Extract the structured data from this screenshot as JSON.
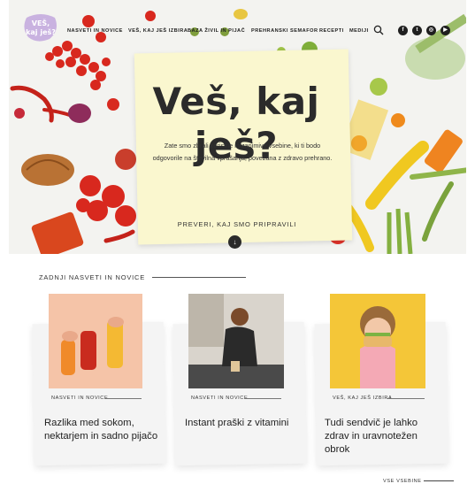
{
  "brand": {
    "logo_text": "VEŠ, kaj ješ?",
    "logo_color": "#c9b2e0"
  },
  "nav": {
    "items": [
      {
        "label": "NASVETI IN NOVICE"
      },
      {
        "label": "VEŠ, KAJ JEŠ IZBIRA"
      },
      {
        "label": "BAZA ŽIVIL IN PIJAČ"
      },
      {
        "label": "PREHRANSKI SEMAFOR"
      },
      {
        "label": "RECEPTI"
      },
      {
        "label": "MEDIJI"
      }
    ],
    "search_icon": "search-icon",
    "social": [
      {
        "icon": "facebook-icon",
        "glyph": "f"
      },
      {
        "icon": "twitter-icon",
        "glyph": "t"
      },
      {
        "icon": "instagram-icon",
        "glyph": "◎"
      },
      {
        "icon": "youtube-icon",
        "glyph": "▶"
      }
    ]
  },
  "hero": {
    "title": "Veš, kaj ješ?",
    "text": "Zate smo zbrali koristne in zanimive vsebine, ki ti bodo odgovorile na številna vprašanja, povezana z zdravo prehrano.",
    "cta": "PREVERI, KAJ SMO PRIPRAVILI",
    "card_color": "#faf7cf"
  },
  "section": {
    "title": "ZADNJI NASVETI IN NOVICE",
    "more_link": "VSE VSEBINE"
  },
  "cards": [
    {
      "category": "NASVETI IN NOVICE",
      "title": "Razlika med sokom, nektarjem in sadno pijačo",
      "img_color": "#f5c4a8"
    },
    {
      "category": "NASVETI IN NOVICE",
      "title": "Instant praški z vitamini",
      "img_color": "#d9d4cc"
    },
    {
      "category": "VEŠ, KAJ JEŠ IZBIRA",
      "title": "Tudi sendvič je lahko zdrav in uravnotežen obrok",
      "img_color": "#f4c638"
    }
  ]
}
